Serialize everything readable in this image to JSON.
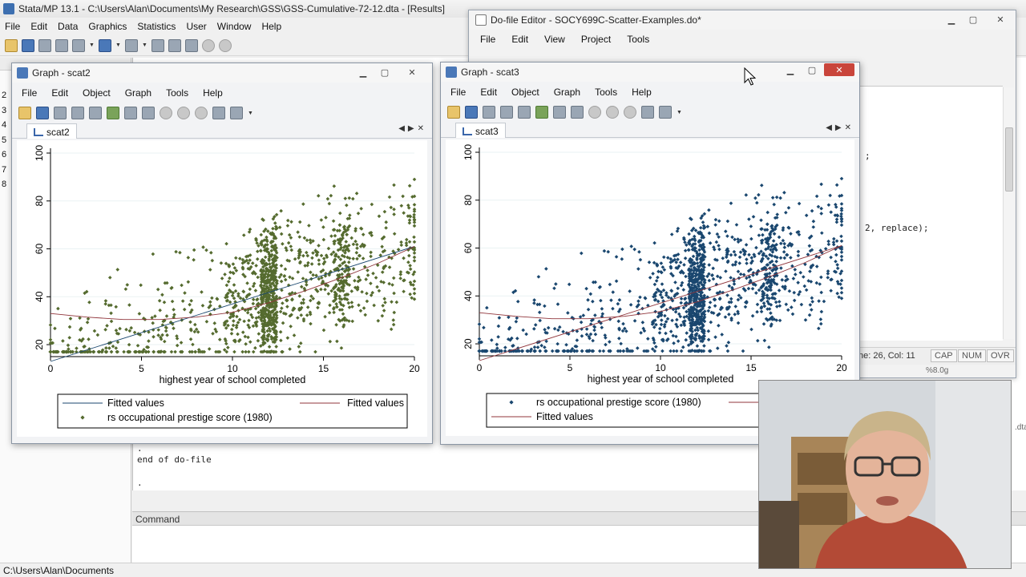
{
  "main": {
    "title": "Stata/MP 13.1 - C:\\Users\\Alan\\Documents\\My Research\\GSS\\GSS-Cumulative-72-12.dta - [Results]",
    "menu": [
      "File",
      "Edit",
      "Data",
      "Graphics",
      "Statistics",
      "User",
      "Window",
      "Help"
    ],
    "results_lines": [
      ".",
      "end of do-file",
      "."
    ],
    "line_numbers": [
      "2",
      "3",
      "4",
      "5",
      "6",
      "7",
      "8"
    ],
    "command_label": "Command",
    "status_path": "C:\\Users\\Alan\\Documents"
  },
  "editor": {
    "title": "Do-file Editor - SOCY699C-Scatter-Examples.do*",
    "menu": [
      "File",
      "Edit",
      "View",
      "Project",
      "Tools"
    ],
    "code_fragment_1": ";",
    "code_fragment_2": "2, replace);",
    "status_position": "ne: 26, Col: 11",
    "status_caps": "CAP",
    "status_num": "NUM",
    "status_ovr": "OVR",
    "behind_text": "%8.0g",
    "behind_dta": ".dta"
  },
  "graph1": {
    "title": "Graph - scat2",
    "menu": [
      "File",
      "Edit",
      "Object",
      "Graph",
      "Tools",
      "Help"
    ],
    "tab_label": "scat2"
  },
  "graph2": {
    "title": "Graph - scat3",
    "menu": [
      "File",
      "Edit",
      "Object",
      "Graph",
      "Tools",
      "Help"
    ],
    "tab_label": "scat3"
  },
  "colors": {
    "graph1_markers": "#556b2f",
    "graph2_markers": "#1a476f",
    "fitted_line_a": "#1a476f",
    "fitted_line_b": "#90353b",
    "close_button": "#c9453b"
  },
  "chart_data": [
    {
      "type": "scatter",
      "name": "scat2",
      "xlabel": "highest year of school completed",
      "ylabel": "",
      "xlim": [
        0,
        20
      ],
      "ylim": [
        15,
        100
      ],
      "xticks": [
        0,
        5,
        10,
        15,
        20
      ],
      "yticks": [
        20,
        40,
        60,
        80,
        100
      ],
      "grid": "horizontal",
      "legend": {
        "placement": "bottom",
        "entries": [
          "Fitted values",
          "Fitted values",
          "rs occupational prestige score  (1980)"
        ]
      },
      "series": [
        {
          "name": "Fitted values",
          "kind": "line",
          "x": [
            0,
            20
          ],
          "y": [
            13,
            61
          ],
          "color": "#1a476f"
        },
        {
          "name": "Fitted values",
          "kind": "line",
          "x": [
            0,
            2,
            4,
            6,
            8,
            10,
            12,
            14,
            16,
            18,
            20
          ],
          "y": [
            33,
            31.5,
            30.5,
            30.5,
            31.5,
            33.5,
            37.5,
            42.5,
            48,
            54,
            61
          ],
          "color": "#90353b"
        },
        {
          "name": "rs occupational prestige score  (1980)",
          "kind": "scatter",
          "color": "#556b2f"
        }
      ]
    },
    {
      "type": "scatter",
      "name": "scat3",
      "xlabel": "highest year of school completed",
      "ylabel": "",
      "xlim": [
        0,
        20
      ],
      "ylim": [
        15,
        100
      ],
      "xticks": [
        0,
        5,
        10,
        15,
        20
      ],
      "yticks": [
        20,
        40,
        60,
        80,
        100
      ],
      "grid": "horizontal",
      "legend": {
        "placement": "bottom",
        "entries": [
          "rs occupational prestige score  (1980)",
          "Fitted values"
        ]
      },
      "series": [
        {
          "name": "rs occupational prestige score  (1980)",
          "kind": "scatter",
          "color": "#1a476f"
        },
        {
          "name": "Fitted values",
          "kind": "line",
          "x": [
            0,
            20
          ],
          "y": [
            13,
            61
          ],
          "color": "#90353b"
        },
        {
          "name": "Fitted values",
          "kind": "line",
          "x": [
            0,
            2,
            4,
            6,
            8,
            10,
            12,
            14,
            16,
            18,
            20
          ],
          "y": [
            33,
            31.5,
            30.5,
            30.5,
            31.5,
            33.5,
            37.5,
            42.5,
            48,
            54,
            61
          ],
          "color": "#90353b"
        }
      ]
    }
  ]
}
